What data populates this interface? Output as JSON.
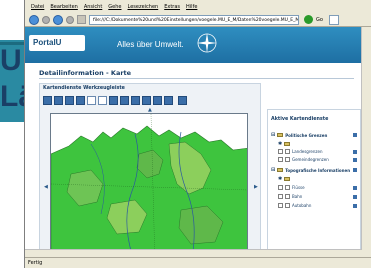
{
  "slide": {
    "frag1": "U",
    "frag2": "Lä"
  },
  "menu": [
    "Datei",
    "Bearbeiten",
    "Ansicht",
    "Gehe",
    "Lesezeichen",
    "Extras",
    "Hilfe"
  ],
  "address": {
    "value": "file:///C:/Dokumente%20und%20Einstellungen/voegele.MU_E_M/Daten%20voegele.MU_E_M",
    "go_label": "Go"
  },
  "site": {
    "logo": "PortalU",
    "tagline": "Alles über Umwelt."
  },
  "page": {
    "title": "Detailinformation - Karte",
    "toolbar_title": "Kartendienste Werkzeugleiste",
    "active_title": "Aktive Kartendienste",
    "groups": [
      {
        "label": "Politische Grenzen",
        "items": [
          "Landesgrenzen",
          "Gemeindegrenzen"
        ]
      },
      {
        "label": "Topografische Informationen",
        "items": [
          "Flüsse",
          "Bahn",
          "Autobahn"
        ]
      }
    ]
  },
  "status": {
    "text": "Fertig"
  },
  "colors": {
    "header": "#1e6fa3",
    "map_green": "#3ec43e",
    "title": "#1a3f66"
  }
}
